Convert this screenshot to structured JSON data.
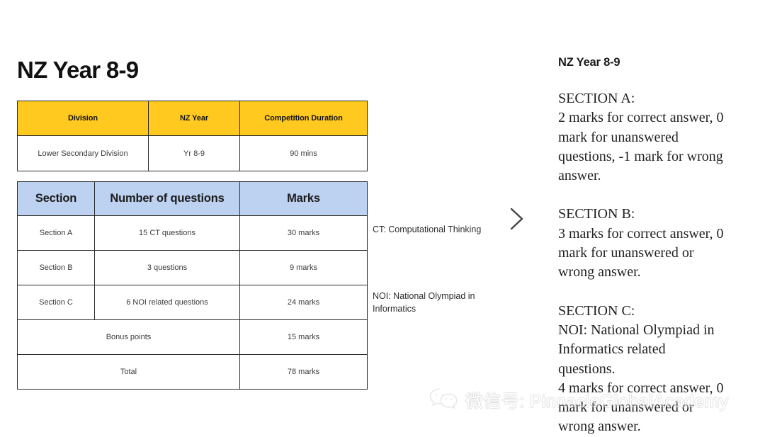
{
  "slide": {
    "title": "NZ Year 8-9"
  },
  "division_table": {
    "headers": [
      "Division",
      "NZ Year",
      "Competition Duration"
    ],
    "rows": [
      [
        "Lower Secondary Division",
        "Yr 8-9",
        "90 mins"
      ]
    ],
    "header_color": "#FFC91F"
  },
  "marks_table": {
    "headers": [
      "Section",
      "Number of questions",
      "Marks"
    ],
    "rows": [
      {
        "section": "Section A",
        "questions": "15 CT questions",
        "marks": "30 marks"
      },
      {
        "section": "Section B",
        "questions": "3 questions",
        "marks": "9 marks"
      },
      {
        "section": "Section C",
        "questions": "6 NOI related questions",
        "marks": "24 marks"
      }
    ],
    "summary_rows": [
      {
        "label": "Bonus points",
        "marks": "15 marks"
      },
      {
        "label": "Total",
        "marks": "78 marks"
      }
    ],
    "header_color": "#BDD2F0"
  },
  "annotations": {
    "ct": "CT: Computational Thinking",
    "noi": "NOI: National Olympiad in Informatics"
  },
  "divider": {
    "icon": "chevron-right-icon"
  },
  "right_panel": {
    "title": "NZ Year 8-9",
    "sections": [
      {
        "heading": "SECTION A:",
        "lines": [
          "2 marks for correct answer, 0",
          "mark for unanswered",
          "questions, -1 mark for wrong",
          "answer."
        ]
      },
      {
        "heading": "SECTION B:",
        "lines": [
          "3 marks for correct answer, 0",
          "mark for unanswered or",
          "wrong answer."
        ]
      },
      {
        "heading": "SECTION C:",
        "lines": [
          "NOI: National Olympiad in",
          "Informatics related",
          "questions.",
          "4 marks for correct answer, 0",
          "mark for unanswered or",
          "wrong answer."
        ]
      }
    ]
  },
  "watermark": {
    "icon": "wechat-icon",
    "text": "微信号: PinnacleGlobalAcademy"
  }
}
